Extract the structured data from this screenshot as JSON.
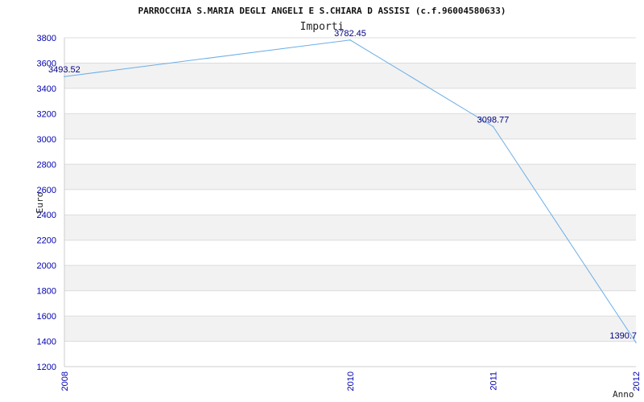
{
  "colors": {
    "line": "#6aaee8",
    "tick_text": "#0000b0",
    "data_label": "#000080",
    "band": "#f2f2f2",
    "gridline": "#dcdcdc",
    "axis": "#cccccc"
  },
  "chart_data": {
    "type": "line",
    "title": "PARROCCHIA S.MARIA DEGLI ANGELI E S.CHIARA D ASSISI (c.f.96004580633)",
    "subtitle": "Importi",
    "xlabel": "Anno",
    "ylabel": "Euro",
    "x": [
      "2008",
      "2010",
      "2011",
      "2012"
    ],
    "values": [
      3493.52,
      3782.45,
      3098.77,
      1390.7
    ],
    "data_labels": [
      "3493.52",
      "3782.45",
      "3098.77",
      "1390.7"
    ],
    "ylim": [
      1200,
      3800
    ],
    "yticks": [
      "1200",
      "1400",
      "1600",
      "1800",
      "2000",
      "2200",
      "2400",
      "2600",
      "2800",
      "3000",
      "3200",
      "3400",
      "3600",
      "3800"
    ],
    "grid": true,
    "legend": "none"
  }
}
